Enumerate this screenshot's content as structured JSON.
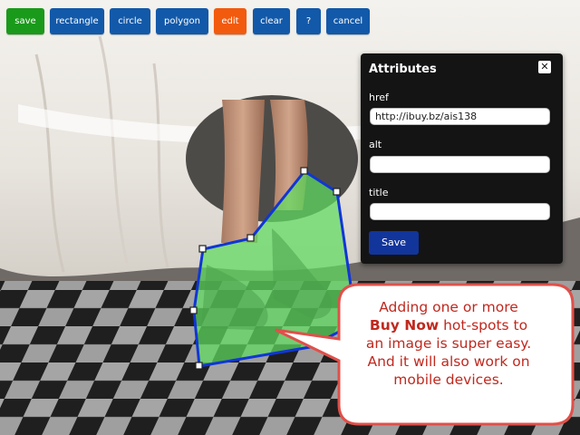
{
  "toolbar": {
    "buttons": [
      {
        "key": "save",
        "label": "save",
        "color": "#1a9a1a"
      },
      {
        "key": "rectangle",
        "label": "rectangle",
        "color": "#1259a9"
      },
      {
        "key": "circle",
        "label": "circle",
        "color": "#1259a9"
      },
      {
        "key": "polygon",
        "label": "polygon",
        "color": "#1259a9"
      },
      {
        "key": "edit",
        "label": "edit",
        "color": "#f25a0e"
      },
      {
        "key": "clear",
        "label": "clear",
        "color": "#1259a9"
      },
      {
        "key": "help",
        "label": "?",
        "color": "#1259a9"
      },
      {
        "key": "cancel",
        "label": "cancel",
        "color": "#1259a9"
      }
    ]
  },
  "attributes_panel": {
    "title": "Attributes",
    "close_icon": "close-icon",
    "fields": [
      {
        "label": "href",
        "value": "http://ibuy.bz/ais138"
      },
      {
        "label": "alt",
        "value": ""
      },
      {
        "label": "title",
        "value": ""
      }
    ],
    "save_label": "Save"
  },
  "callout": {
    "line1": "Adding one or more",
    "line2_bold": "Buy Now",
    "line2_rest": " hot-spots to",
    "line3": "an image is super easy.",
    "line4": "And it will also work on",
    "line5": "mobile devices."
  },
  "colors": {
    "hotspot_fill": "#5fdc5f",
    "hotspot_stroke": "#1036d6",
    "callout_border": "#e0504a",
    "callout_text": "#c0291f",
    "panel_bg": "#141414"
  }
}
